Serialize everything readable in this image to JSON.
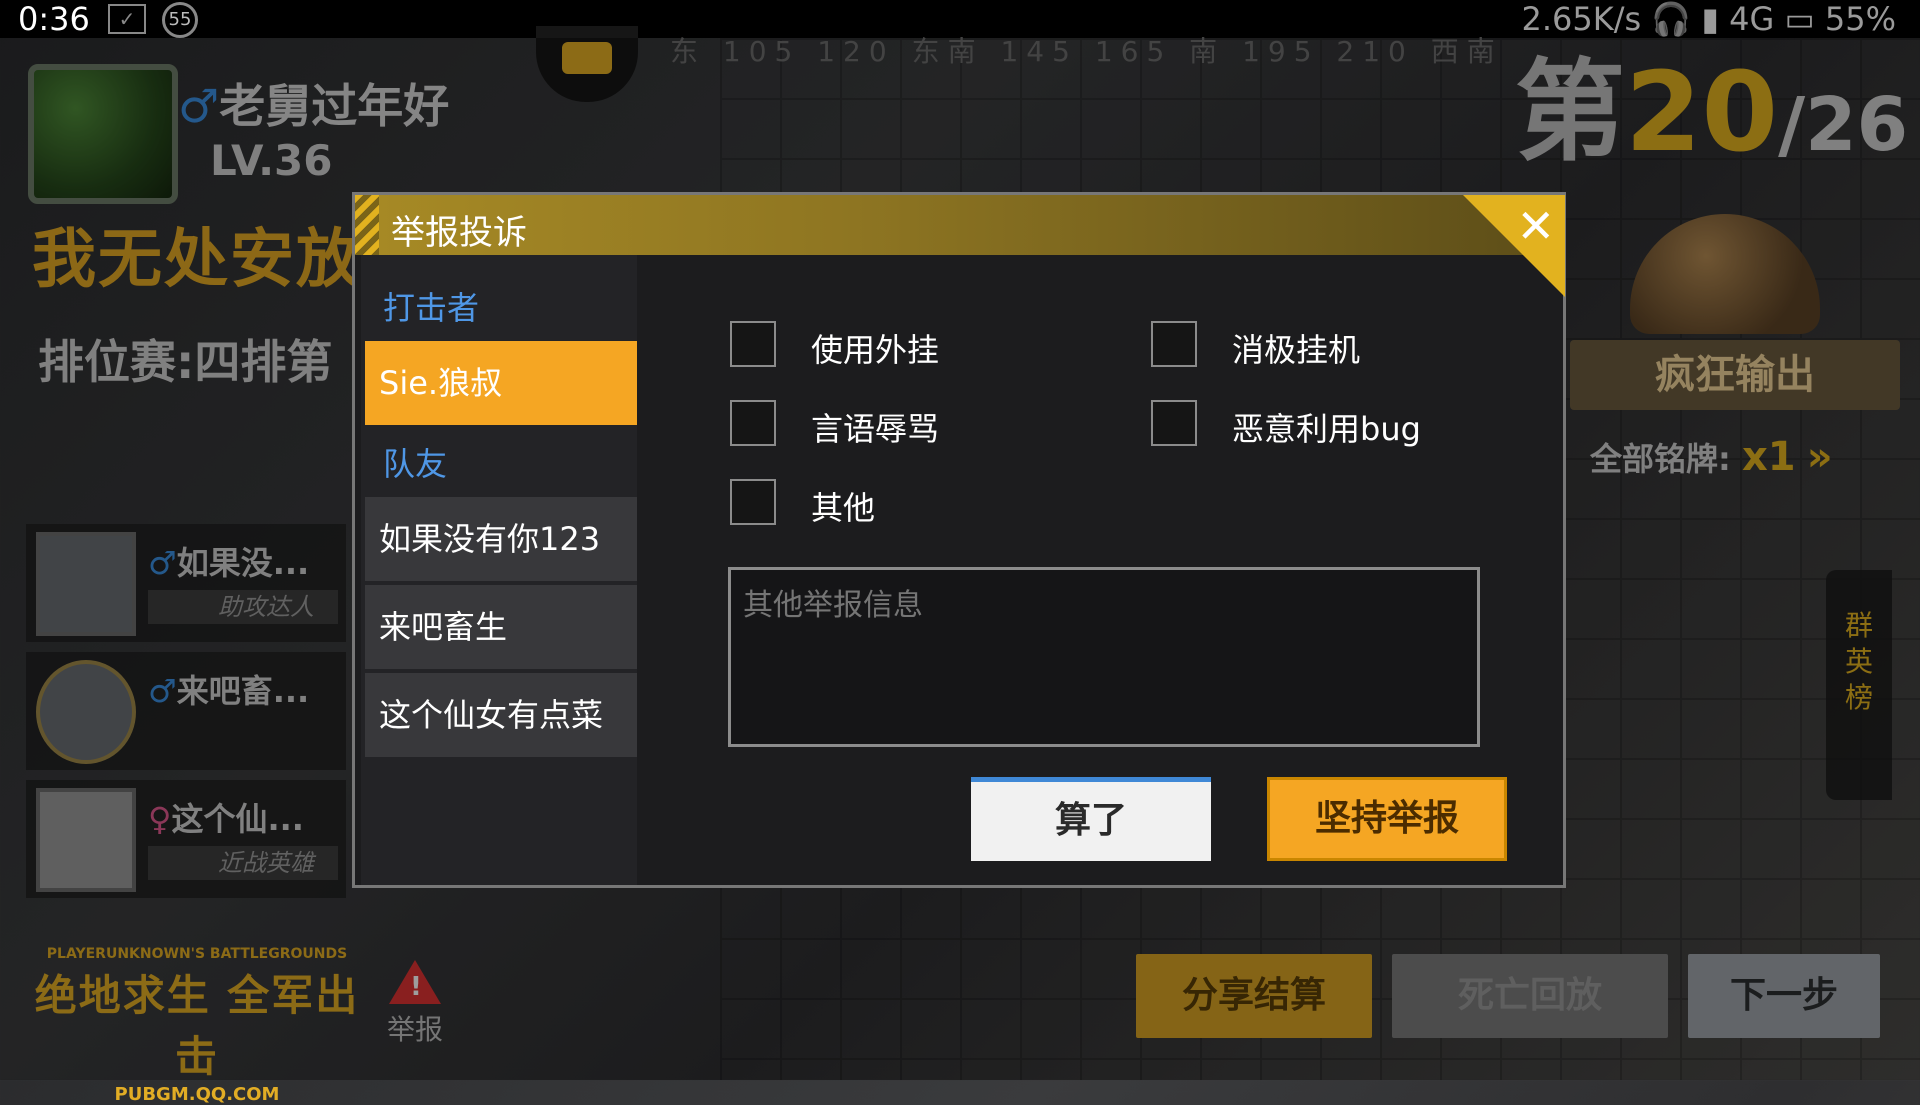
{
  "status_bar": {
    "time": "0:36",
    "badge": "55",
    "network": "2.65K/s",
    "signal": "4G",
    "battery": "55%"
  },
  "player": {
    "gender": "♂",
    "name": "老舅过年好",
    "level": "LV.36",
    "motto": "我无处安放",
    "match_type": "排位赛:四排第"
  },
  "rank": {
    "prefix": "第",
    "place": "20",
    "total": "/26"
  },
  "compass": "东  105  120  东南  145  165  南  195  210  西南",
  "teammates": [
    {
      "gender": "♂",
      "name": "如果没...",
      "badge": "助攻达人"
    },
    {
      "gender": "♂",
      "name": "来吧畜...",
      "badge": ""
    },
    {
      "gender": "♀",
      "name": "这个仙...",
      "badge": "近战英雄"
    }
  ],
  "award": {
    "title": "疯狂输出",
    "medals_label": "全部铭牌:",
    "medals_value": "x1",
    "arrow": "»"
  },
  "hero_board": "群英榜",
  "logo": {
    "small": "PLAYERUNKNOWN'S BATTLEGROUNDS",
    "big": "绝地求生 全军出击",
    "url": "PUBGM.QQ.COM"
  },
  "report_link": {
    "icon": "!",
    "label": "举报"
  },
  "bottom_buttons": {
    "share": "分享结算",
    "replay": "死亡回放",
    "next": "下一步"
  },
  "dialog": {
    "title": "举报投诉",
    "close_icon": "✕",
    "attacker_label": "打击者",
    "attacker": "Sie.狼叔",
    "teammates_label": "队友",
    "teammate_list": [
      "如果没有你123",
      "来吧畜生",
      "这个仙女有点菜"
    ],
    "reasons": [
      "使用外挂",
      "消极挂机",
      "言语辱骂",
      "恶意利用bug",
      "其他"
    ],
    "textarea_placeholder": "其他举报信息",
    "cancel": "算了",
    "submit": "坚持举报"
  },
  "colors": {
    "accent": "#f5a623",
    "link_blue": "#4f97e6",
    "cancel_border": "#3f88d6"
  }
}
